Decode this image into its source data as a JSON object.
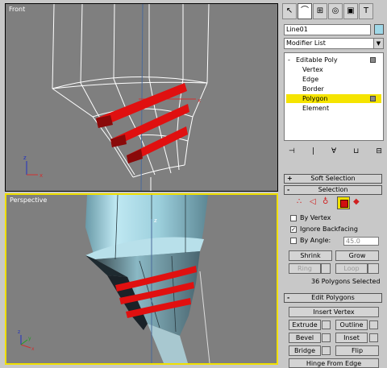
{
  "viewports": {
    "front_label": "Front",
    "perspective_label": "Perspective",
    "axis_x": "x",
    "axis_y": "y",
    "axis_z": "z"
  },
  "command_panel": {
    "tab_icons": [
      "cursor-icon",
      "bend-icon",
      "hierarchy-icon",
      "motion-icon",
      "display-icon",
      "utilities-icon"
    ],
    "object_name": "Line01",
    "object_color": "#9fd8e8",
    "modifier_list": "Modifier List",
    "stack": {
      "root": "Editable Poly",
      "items": [
        "Vertex",
        "Edge",
        "Border",
        "Polygon",
        "Element"
      ],
      "selected": "Polygon"
    },
    "rollouts": {
      "soft_selection": "Soft Selection",
      "selection": "Selection",
      "edit_polygons": "Edit Polygons"
    },
    "selection": {
      "by_vertex": "By Vertex",
      "ignore_backfacing": "Ignore Backfacing",
      "by_angle": "By Angle:",
      "angle_value": "45.0",
      "shrink": "Shrink",
      "grow": "Grow",
      "ring": "Ring",
      "loop": "Loop",
      "status": "36 Polygons Selected"
    },
    "edit_polygons": {
      "insert_vertex": "Insert Vertex",
      "extrude": "Extrude",
      "outline": "Outline",
      "bevel": "Bevel",
      "inset": "Inset",
      "bridge": "Bridge",
      "flip": "Flip",
      "hinge": "Hinge From Edge"
    },
    "minus": "-",
    "plus": "+",
    "check": "✓"
  }
}
